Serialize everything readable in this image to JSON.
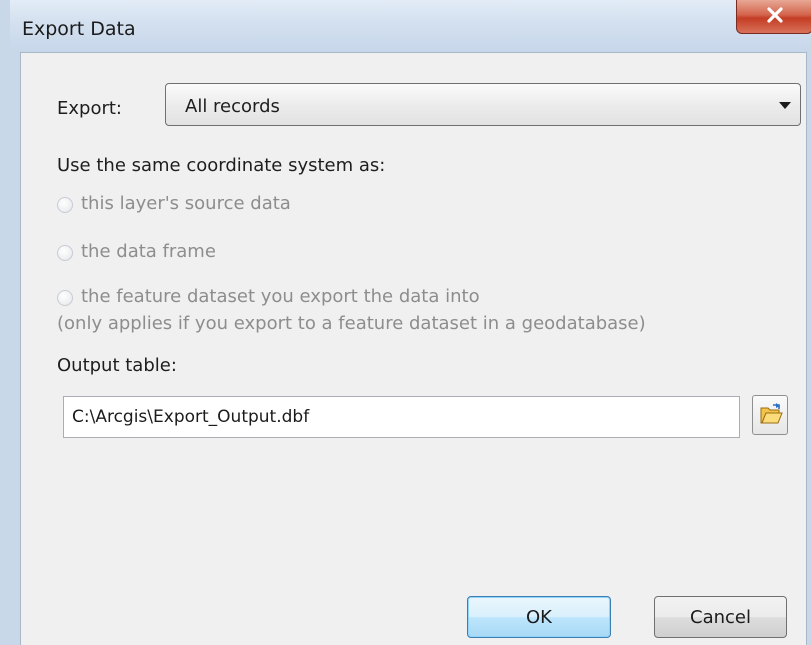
{
  "window": {
    "title": "Export Data"
  },
  "export": {
    "label": "Export:",
    "selected": "All records"
  },
  "coordinate": {
    "heading": "Use the same coordinate system as:",
    "options": [
      {
        "label": "this layer's source data"
      },
      {
        "label": "the data frame"
      },
      {
        "label": "the feature dataset you export the data into",
        "sub": "(only applies if you export to a feature dataset in a geodatabase)"
      }
    ]
  },
  "output": {
    "label": "Output table:",
    "value": "C:\\Arcgis\\Export_Output.dbf"
  },
  "buttons": {
    "ok": "OK",
    "cancel": "Cancel"
  },
  "icons": {
    "close": "close-icon",
    "dropdown": "chevron-down-icon",
    "browse": "open-folder-icon"
  }
}
